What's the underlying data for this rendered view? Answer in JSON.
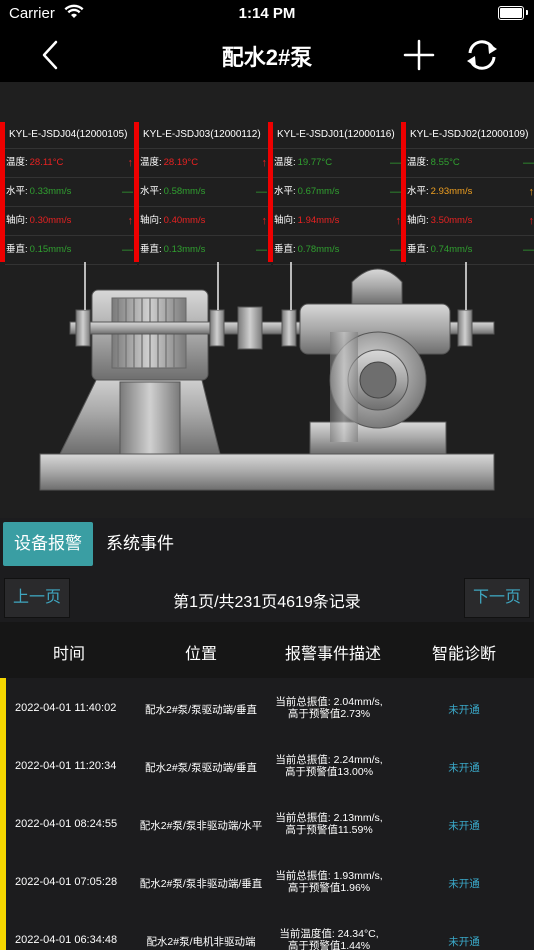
{
  "status_bar": {
    "carrier": "Carrier",
    "time": "1:14 PM"
  },
  "nav": {
    "title": "配水2#泵"
  },
  "sensors": [
    {
      "id": "KYL-E-JSDJ04(12000105)",
      "rows": [
        {
          "label": "温度:",
          "value": "28.11°C",
          "status": "red",
          "indicator": "up"
        },
        {
          "label": "水平:",
          "value": "0.33mm/s",
          "status": "green",
          "indicator": "flat"
        },
        {
          "label": "轴向:",
          "value": "0.30mm/s",
          "status": "red",
          "indicator": "up"
        },
        {
          "label": "垂直:",
          "value": "0.15mm/s",
          "status": "green",
          "indicator": "flat"
        }
      ]
    },
    {
      "id": "KYL-E-JSDJ03(12000112)",
      "rows": [
        {
          "label": "温度:",
          "value": "28.19°C",
          "status": "red",
          "indicator": "up"
        },
        {
          "label": "水平:",
          "value": "0.58mm/s",
          "status": "green",
          "indicator": "flat"
        },
        {
          "label": "轴向:",
          "value": "0.40mm/s",
          "status": "red",
          "indicator": "up"
        },
        {
          "label": "垂直:",
          "value": "0.13mm/s",
          "status": "green",
          "indicator": "flat"
        }
      ]
    },
    {
      "id": "KYL-E-JSDJ01(12000116)",
      "rows": [
        {
          "label": "温度:",
          "value": "19.77°C",
          "status": "green",
          "indicator": "flat"
        },
        {
          "label": "水平:",
          "value": "0.67mm/s",
          "status": "green",
          "indicator": "flat"
        },
        {
          "label": "轴向:",
          "value": "1.94mm/s",
          "status": "red",
          "indicator": "up"
        },
        {
          "label": "垂直:",
          "value": "0.78mm/s",
          "status": "green",
          "indicator": "flat"
        }
      ]
    },
    {
      "id": "KYL-E-JSDJ02(12000109)",
      "rows": [
        {
          "label": "温度:",
          "value": "8.55°C",
          "status": "green",
          "indicator": "flat"
        },
        {
          "label": "水平:",
          "value": "2.93mm/s",
          "status": "orange",
          "indicator": "up"
        },
        {
          "label": "轴向:",
          "value": "3.50mm/s",
          "status": "red",
          "indicator": "up"
        },
        {
          "label": "垂直:",
          "value": "0.74mm/s",
          "status": "green",
          "indicator": "flat"
        }
      ]
    }
  ],
  "tabs": {
    "alarm": "设备报警",
    "events": "系统事件"
  },
  "pager": {
    "prev": "上一页",
    "info": "第1页/共231页4619条记录",
    "next": "下一页"
  },
  "table": {
    "headers": {
      "time": "时间",
      "position": "位置",
      "description": "报警事件描述",
      "diagnosis": "智能诊断"
    },
    "rows": [
      {
        "time": "2022-04-01 11:40:02",
        "position": "配水2#泵/泵驱动端/垂直",
        "desc1": "当前总振值: 2.04mm/s,",
        "desc2": "高于预警值2.73%",
        "diagnosis": "未开通"
      },
      {
        "time": "2022-04-01 11:20:34",
        "position": "配水2#泵/泵驱动端/垂直",
        "desc1": "当前总振值: 2.24mm/s,",
        "desc2": "高于预警值13.00%",
        "diagnosis": "未开通"
      },
      {
        "time": "2022-04-01 08:24:55",
        "position": "配水2#泵/泵非驱动端/水平",
        "desc1": "当前总振值: 2.13mm/s,",
        "desc2": "高于预警值11.59%",
        "diagnosis": "未开通"
      },
      {
        "time": "2022-04-01 07:05:28",
        "position": "配水2#泵/泵非驱动端/垂直",
        "desc1": "当前总振值: 1.93mm/s,",
        "desc2": "高于预警值1.96%",
        "diagnosis": "未开通"
      },
      {
        "time": "2022-04-01 06:34:48",
        "position": "配水2#泵/电机非驱动端",
        "desc1": "当前温度值: 24.34°C,",
        "desc2": "高于预警值1.44%",
        "diagnosis": "未开通"
      }
    ]
  },
  "icons": {
    "back": "chevron-left-icon",
    "add": "plus-icon",
    "refresh": "refresh-icon",
    "wifi": "wifi-icon",
    "battery": "battery-icon"
  },
  "colors": {
    "accent": "#3a9ea3",
    "alarm": "#e82222",
    "ok": "#30a030",
    "warn": "#f0a020",
    "highlight": "#f5d700",
    "link": "#3aa8c8"
  }
}
